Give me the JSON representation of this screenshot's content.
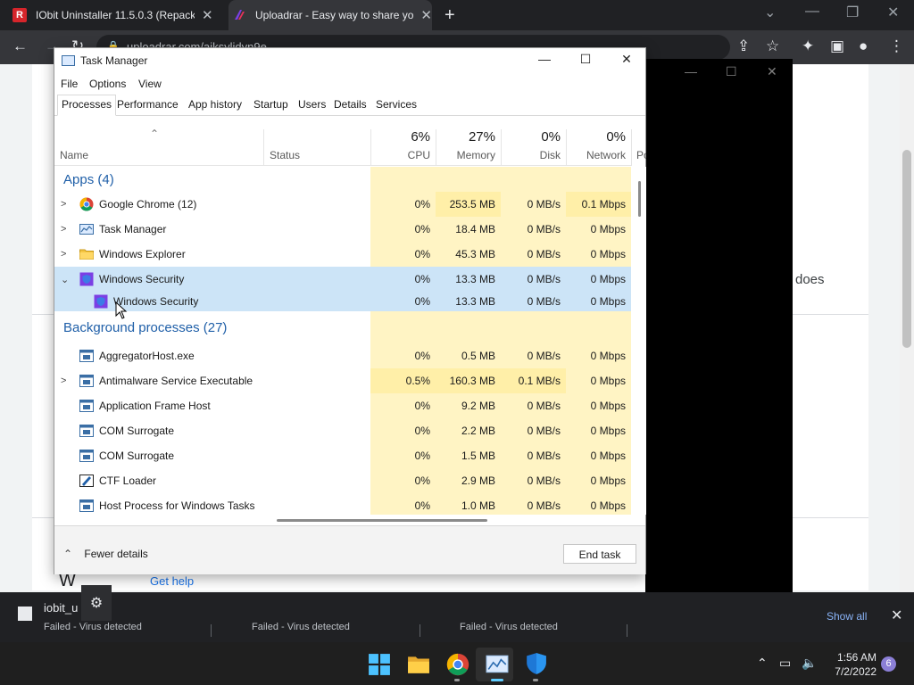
{
  "browser": {
    "tabs": [
      {
        "title": "IObit Uninstaller 11.5.0.3 (Repack",
        "favicon": "R"
      },
      {
        "title": "Uploadrar - Easy way to share yo"
      }
    ],
    "url": "uploadrar.com/aiksylidyn9e",
    "colors": {
      "frame": "#202124",
      "toolbar": "#35363a"
    }
  },
  "page": {
    "partial_text": "does",
    "help_link": "Get help",
    "heading_fragment": "W"
  },
  "task_manager": {
    "title": "Task Manager",
    "menu": [
      "File",
      "Options",
      "View"
    ],
    "tabs": [
      "Processes",
      "Performance",
      "App history",
      "Startup",
      "Users",
      "Details",
      "Services"
    ],
    "active_tab": "Processes",
    "columns": {
      "name": "Name",
      "status": "Status",
      "cpu": {
        "pct": "6%",
        "label": "CPU"
      },
      "memory": {
        "pct": "27%",
        "label": "Memory"
      },
      "disk": {
        "pct": "0%",
        "label": "Disk"
      },
      "network": {
        "pct": "0%",
        "label": "Network"
      },
      "power_cut": "Po"
    },
    "groups": {
      "apps": "Apps (4)",
      "background": "Background processes (27)"
    },
    "apps": [
      {
        "name": "Google Chrome (12)",
        "cpu": "0%",
        "mem": "253.5 MB",
        "disk": "0 MB/s",
        "net": "0.1 Mbps",
        "icon": "chrome-icon"
      },
      {
        "name": "Task Manager",
        "cpu": "0%",
        "mem": "18.4 MB",
        "disk": "0 MB/s",
        "net": "0 Mbps",
        "icon": "task-manager-icon"
      },
      {
        "name": "Windows Explorer",
        "cpu": "0%",
        "mem": "45.3 MB",
        "disk": "0 MB/s",
        "net": "0 Mbps",
        "icon": "folder-icon"
      },
      {
        "name": "Windows Security",
        "cpu": "0%",
        "mem": "13.3 MB",
        "disk": "0 MB/s",
        "net": "0 Mbps",
        "icon": "security-icon"
      },
      {
        "name": "Windows Security",
        "cpu": "0%",
        "mem": "13.3 MB",
        "disk": "0 MB/s",
        "net": "0 Mbps",
        "icon": "security-icon"
      }
    ],
    "background": [
      {
        "name": "AggregatorHost.exe",
        "cpu": "0%",
        "mem": "0.5 MB",
        "disk": "0 MB/s",
        "net": "0 Mbps"
      },
      {
        "name": "Antimalware Service Executable",
        "cpu": "0.5%",
        "mem": "160.3 MB",
        "disk": "0.1 MB/s",
        "net": "0 Mbps"
      },
      {
        "name": "Application Frame Host",
        "cpu": "0%",
        "mem": "9.2 MB",
        "disk": "0 MB/s",
        "net": "0 Mbps"
      },
      {
        "name": "COM Surrogate",
        "cpu": "0%",
        "mem": "2.2 MB",
        "disk": "0 MB/s",
        "net": "0 Mbps"
      },
      {
        "name": "COM Surrogate",
        "cpu": "0%",
        "mem": "1.5 MB",
        "disk": "0 MB/s",
        "net": "0 Mbps"
      },
      {
        "name": "CTF Loader",
        "cpu": "0%",
        "mem": "2.9 MB",
        "disk": "0 MB/s",
        "net": "0 Mbps"
      },
      {
        "name": "Host Process for Windows Tasks",
        "cpu": "0%",
        "mem": "1.0 MB",
        "disk": "0 MB/s",
        "net": "0 Mbps"
      }
    ],
    "footer": {
      "fewer": "Fewer details",
      "end_task": "End task"
    }
  },
  "downloads": {
    "name": "iobit_u",
    "statuses": [
      "Failed - Virus detected",
      "Failed - Virus detected",
      "Failed - Virus detected"
    ],
    "show_all": "Show all"
  },
  "taskbar": {
    "time": "1:56 AM",
    "date": "7/2/2022",
    "notifications": "6"
  }
}
